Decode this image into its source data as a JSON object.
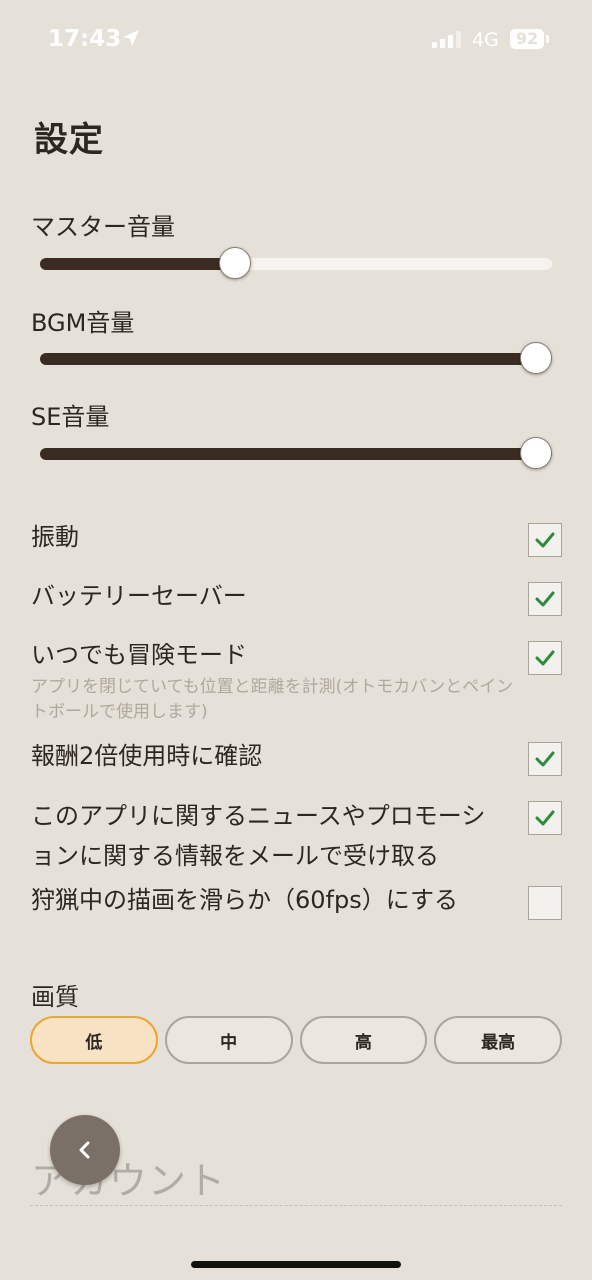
{
  "status_bar": {
    "time": "17:43",
    "network": "4G",
    "battery": "92"
  },
  "page": {
    "title": "設定"
  },
  "volumes": [
    {
      "label": "マスター音量",
      "value": 0.38
    },
    {
      "label": "BGM音量",
      "value": 1.0
    },
    {
      "label": "SE音量",
      "value": 1.0
    }
  ],
  "options": [
    {
      "label": "振動",
      "checked": true
    },
    {
      "label": "バッテリーセーバー",
      "checked": true
    },
    {
      "label": "いつでも冒険モード",
      "description": "アプリを閉じていても位置と距離を計測(オトモカバンとペイントボールで使用します)",
      "checked": true
    },
    {
      "label": "報酬2倍使用時に確認",
      "checked": true
    },
    {
      "label": "このアプリに関するニュースやプロモーションに関する情報をメールで受け取る",
      "checked": true
    },
    {
      "label": "狩猟中の描画を滑らか（60fps）にする",
      "checked": false
    }
  ],
  "quality": {
    "label": "画質",
    "options": [
      "低",
      "中",
      "高",
      "最高"
    ],
    "selected": "低"
  },
  "account": {
    "label": "アカウント"
  },
  "colors": {
    "accent": "#e8a634",
    "check": "#2f8a3a",
    "slider_fill": "#3a2c22"
  },
  "icons": {
    "back": "chevron-left-icon",
    "location": "location-arrow-icon",
    "check": "checkmark-icon"
  }
}
